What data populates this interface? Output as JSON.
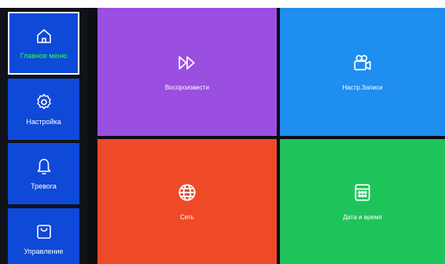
{
  "sidebar": {
    "items": [
      {
        "label": "Главное меню",
        "icon": "home-icon",
        "active": true
      },
      {
        "label": "Настройка",
        "icon": "gear-icon",
        "active": false
      },
      {
        "label": "Тревога",
        "icon": "bell-icon",
        "active": false
      },
      {
        "label": "Управление",
        "icon": "shopping-bag-icon",
        "active": false
      }
    ],
    "active_label_color": "#2cff5a",
    "item_color": "#0e49d8"
  },
  "tiles": [
    {
      "label": "Воспроизвести",
      "icon": "fast-forward-icon",
      "color": "#9a4fe0"
    },
    {
      "label": "Настр.Записи",
      "icon": "video-camera-icon",
      "color": "#1e8ef0"
    },
    {
      "label": "Сеть",
      "icon": "globe-icon",
      "color": "#ee4a28"
    },
    {
      "label": "Дата и время",
      "icon": "calendar-icon",
      "color": "#1ec45a"
    }
  ]
}
